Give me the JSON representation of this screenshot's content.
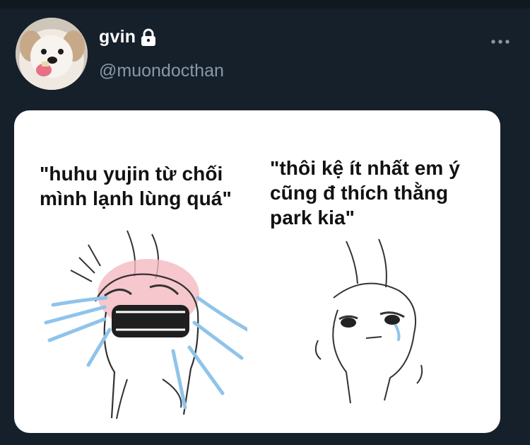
{
  "tweet": {
    "author": {
      "display_name": "gvin",
      "handle": "@muondocthan",
      "avatar_icon": "dog-avatar",
      "protected_icon": "lock-icon"
    },
    "more_icon": "more-horizontal-icon",
    "media": {
      "left_caption": "\"huhu yujin từ chối\nmình lạnh lùng quá\"",
      "right_caption": "\"thôi kệ ít nhất em ý\ncũng đ thích thằng\npark kia\""
    }
  },
  "colors": {
    "background": "#15202b",
    "text_primary": "#ffffff",
    "text_secondary": "#8899a6",
    "card": "#ffffff"
  }
}
